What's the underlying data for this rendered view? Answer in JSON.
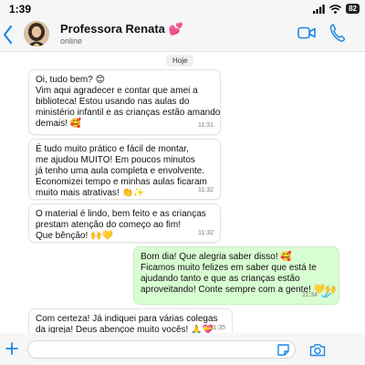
{
  "status_bar": {
    "time": "1:39",
    "battery": "82"
  },
  "header": {
    "contact_name": "Professora Renata 💕",
    "contact_status": "online",
    "icons": [
      "back-chevron-icon",
      "avatar",
      "video-call-icon",
      "voice-call-icon"
    ]
  },
  "chat": {
    "date_chip": "Hoje",
    "messages": [
      {
        "direction": "in",
        "lines": [
          "Oi, tudo bem? 😊",
          "Vim aqui agradecer e contar que amei a",
          "biblioteca! Estou usando nas aulas do",
          "ministério infantil e as crianças estão amando",
          "demais! 🥰"
        ],
        "time": "11:31"
      },
      {
        "direction": "in",
        "lines": [
          "É tudo muito prático e fácil de montar,",
          "me ajudou MUITO! Em poucos minutos",
          "já tenho uma aula completa e envolvente.",
          "Economizei tempo e minhas aulas ficaram",
          "muito mais atrativas! 👏✨"
        ],
        "time": "11:32"
      },
      {
        "direction": "in",
        "lines": [
          "O material é lindo, bem feito e as crianças",
          "prestam atenção do começo ao fim!",
          "Que bênção! 🙌💛"
        ],
        "time": "11:32"
      },
      {
        "direction": "out",
        "lines": [
          "Bom dia! Que alegria saber disso! 🥰",
          "Ficamos muito felizes em saber que está te",
          "ajudando tanto e que as crianças estão",
          "aproveitando! Conte sempre com a gente! 💛🙌"
        ],
        "time": "11:34",
        "read": true
      },
      {
        "direction": "in",
        "lines": [
          "Com certeza! Já indiquei para várias colegas",
          "da igreja! Deus abençoe muito vocês! 🙏💝"
        ],
        "time": "11:35"
      }
    ]
  },
  "input": {
    "placeholder": "",
    "value": ""
  },
  "colors": {
    "outgoing_bubble": "#d9fdd3",
    "incoming_bubble": "#ffffff",
    "accent_blue": "#1e88e5",
    "read_ticks": "#34b7f1",
    "header_bg": "#f6f6f6"
  }
}
